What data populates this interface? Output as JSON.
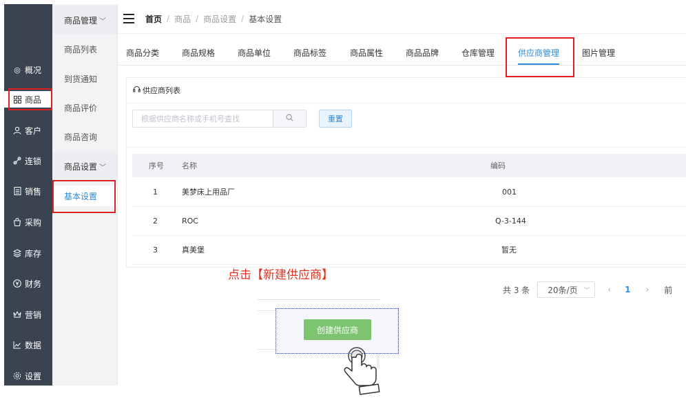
{
  "sidebar": {
    "items": [
      {
        "label": "概况",
        "icon": "dashboard-icon"
      },
      {
        "label": "商品",
        "icon": "grid-icon"
      },
      {
        "label": "客户",
        "icon": "user-icon"
      },
      {
        "label": "连锁",
        "icon": "link-icon"
      },
      {
        "label": "销售",
        "icon": "document-icon"
      },
      {
        "label": "采购",
        "icon": "bag-icon"
      },
      {
        "label": "库存",
        "icon": "layers-icon"
      },
      {
        "label": "财务",
        "icon": "yen-icon"
      },
      {
        "label": "营销",
        "icon": "crown-icon"
      },
      {
        "label": "数据",
        "icon": "chart-icon"
      },
      {
        "label": "设置",
        "icon": "gear-icon"
      }
    ],
    "active_index": 1
  },
  "subnav": {
    "group1": "商品管理",
    "group1_items": [
      "商品列表",
      "到货通知",
      "商品评价",
      "商品咨询"
    ],
    "group2": "商品设置",
    "group2_items": [
      "基本设置"
    ]
  },
  "breadcrumb": {
    "home": "首页",
    "level1": "商品",
    "level2": "商品设置",
    "current": "基本设置"
  },
  "tabs": [
    "商品分类",
    "商品规格",
    "商品单位",
    "商品标签",
    "商品属性",
    "商品品牌",
    "仓库管理",
    "供应商管理",
    "图片管理"
  ],
  "active_tab_index": 7,
  "panel": {
    "title": "供应商列表"
  },
  "search": {
    "placeholder": "根据供应商名称或手机号查找",
    "value": "",
    "reset_label": "重置"
  },
  "table": {
    "headers": {
      "index": "序号",
      "name": "名称",
      "code": "编码"
    },
    "rows": [
      {
        "index": "1",
        "name": "美梦床上用品厂",
        "code": "001"
      },
      {
        "index": "2",
        "name": "ROC",
        "code": "Q-3-144"
      },
      {
        "index": "3",
        "name": "真美堡",
        "code": "暂无"
      }
    ]
  },
  "instruction": "点击【新建供应商】",
  "pagination": {
    "total": "共 3 条",
    "page_size": "20条/页",
    "current_page": "1",
    "tail": "前"
  },
  "create_button": "创建供应商",
  "colors": {
    "sidebar_bg": "#3a4350",
    "accent": "#2e8bd8",
    "highlight": "#e02020",
    "create_button": "#7cc46f"
  }
}
